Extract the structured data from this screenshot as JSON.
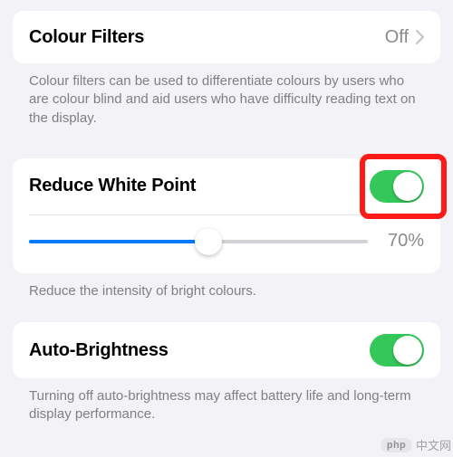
{
  "colourFilters": {
    "label": "Colour Filters",
    "value": "Off",
    "description": "Colour filters can be used to differentiate colours by users who are colour blind and aid users who have difficulty reading text on the display."
  },
  "reduceWhitePoint": {
    "label": "Reduce White Point",
    "enabled": true,
    "sliderPercent": 53,
    "valueText": "70%",
    "description": "Reduce the intensity of bright colours."
  },
  "autoBrightness": {
    "label": "Auto-Brightness",
    "enabled": true,
    "description": "Turning off auto-brightness may affect battery life and long-term display performance."
  },
  "watermark": {
    "badge": "php",
    "text": "中文网"
  },
  "colors": {
    "toggleOn": "#34c759",
    "sliderFill": "#007aff",
    "highlight": "#ff1a1a"
  }
}
